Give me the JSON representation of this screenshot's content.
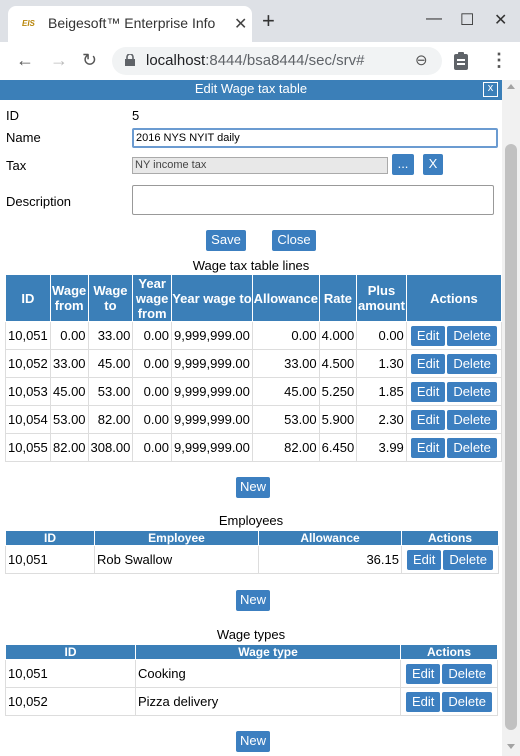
{
  "browser": {
    "tab_title": "Beigesoft™ Enterprise Info",
    "favicon_text": "EIS",
    "url_host": "localhost",
    "url_rest": ":8444/bsa8444/sec/srv#"
  },
  "dialog": {
    "title": "Edit Wage tax table",
    "close_label": "x",
    "id_label": "ID",
    "id_value": "5",
    "name_label": "Name",
    "name_value": "2016 NYS NYIT daily",
    "tax_label": "Tax",
    "tax_value": "NY income tax",
    "tax_pick_label": "...",
    "tax_clear_label": "X",
    "description_label": "Description",
    "description_value": "",
    "save_label": "Save",
    "close_button_label": "Close"
  },
  "lines": {
    "title": "Wage tax table lines",
    "headers": [
      "ID",
      "Wage from",
      "Wage to",
      "Year wage from",
      "Year wage to",
      "Allowance",
      "Rate",
      "Plus amount",
      "Actions"
    ],
    "rows": [
      [
        "10,051",
        "0.00",
        "33.00",
        "0.00",
        "9,999,999.00",
        "0.00",
        "4.000",
        "0.00"
      ],
      [
        "10,052",
        "33.00",
        "45.00",
        "0.00",
        "9,999,999.00",
        "33.00",
        "4.500",
        "1.30"
      ],
      [
        "10,053",
        "45.00",
        "53.00",
        "0.00",
        "9,999,999.00",
        "45.00",
        "5.250",
        "1.85"
      ],
      [
        "10,054",
        "53.00",
        "82.00",
        "0.00",
        "9,999,999.00",
        "53.00",
        "5.900",
        "2.30"
      ],
      [
        "10,055",
        "82.00",
        "308.00",
        "0.00",
        "9,999,999.00",
        "82.00",
        "6.450",
        "3.99"
      ]
    ],
    "edit_label": "Edit",
    "delete_label": "Delete",
    "new_label": "New"
  },
  "employees": {
    "title": "Employees",
    "headers": [
      "ID",
      "Employee",
      "Allowance",
      "Actions"
    ],
    "rows": [
      [
        "10,051",
        "Rob Swallow",
        "36.15"
      ]
    ],
    "edit_label": "Edit",
    "delete_label": "Delete",
    "new_label": "New"
  },
  "wage_types": {
    "title": "Wage types",
    "headers": [
      "ID",
      "Wage type",
      "Actions"
    ],
    "rows": [
      [
        "10,051",
        "Cooking"
      ],
      [
        "10,052",
        "Pizza delivery"
      ]
    ],
    "edit_label": "Edit",
    "delete_label": "Delete",
    "new_label": "New"
  },
  "colors": {
    "accent": "#3b7fb8",
    "button": "#3c7fc0"
  }
}
